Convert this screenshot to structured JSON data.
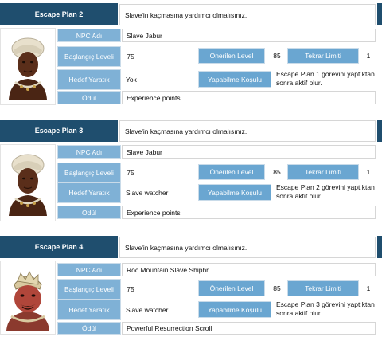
{
  "colors": {
    "header_dark": "#1f4e6e",
    "label_blue": "#7fb1d6",
    "label_blue_alt": "#6aa6d1",
    "portrait_skin_dark": "#5a2e1a",
    "portrait_skin_red": "#b0463a",
    "turban": "#e8e0cc"
  },
  "labels": {
    "npc_name": "NPC Adı",
    "start_level": "Başlangıç Leveli",
    "target_creature": "Hedef Yaratık",
    "reward": "Ödül",
    "recommended_level": "Önerilen Level",
    "repeat_limit": "Tekrar Limiti",
    "requirement": "Yapabilme Koşulu"
  },
  "quests": [
    {
      "title": "Escape Plan 2",
      "description": "Slave'in kaçmasına yardımcı olmalısınız.",
      "portrait_icon": "slave-jabur-portrait",
      "npc_name": "Slave Jabur",
      "start_level": "75",
      "recommended_level": "85",
      "repeat_limit": "1",
      "target_creature": "Yok",
      "requirement": "Escape Plan 1 görevini yaptıktan sonra aktif olur.",
      "reward": "Experience points"
    },
    {
      "title": "Escape Plan 3",
      "description": "Slave'in kaçmasına yardımcı olmalısınız.",
      "portrait_icon": "slave-jabur-portrait",
      "npc_name": "Slave Jabur",
      "start_level": "75",
      "recommended_level": "85",
      "repeat_limit": "1",
      "target_creature": "Slave watcher",
      "requirement": "Escape Plan 2 görevini yaptıktan sonra aktif olur.",
      "reward": "Experience points"
    },
    {
      "title": "Escape Plan 4",
      "description": "Slave'in kaçmasına yardımcı olmalısınız.",
      "portrait_icon": "roc-mountain-slave-shiphr-portrait",
      "npc_name": "Roc Mountain Slave Shiphr",
      "start_level": "75",
      "recommended_level": "85",
      "repeat_limit": "1",
      "target_creature": "Slave watcher",
      "requirement": "Escape Plan 3 görevini yaptıktan sonra aktif olur.",
      "reward": "Powerful Resurrection Scroll"
    }
  ]
}
